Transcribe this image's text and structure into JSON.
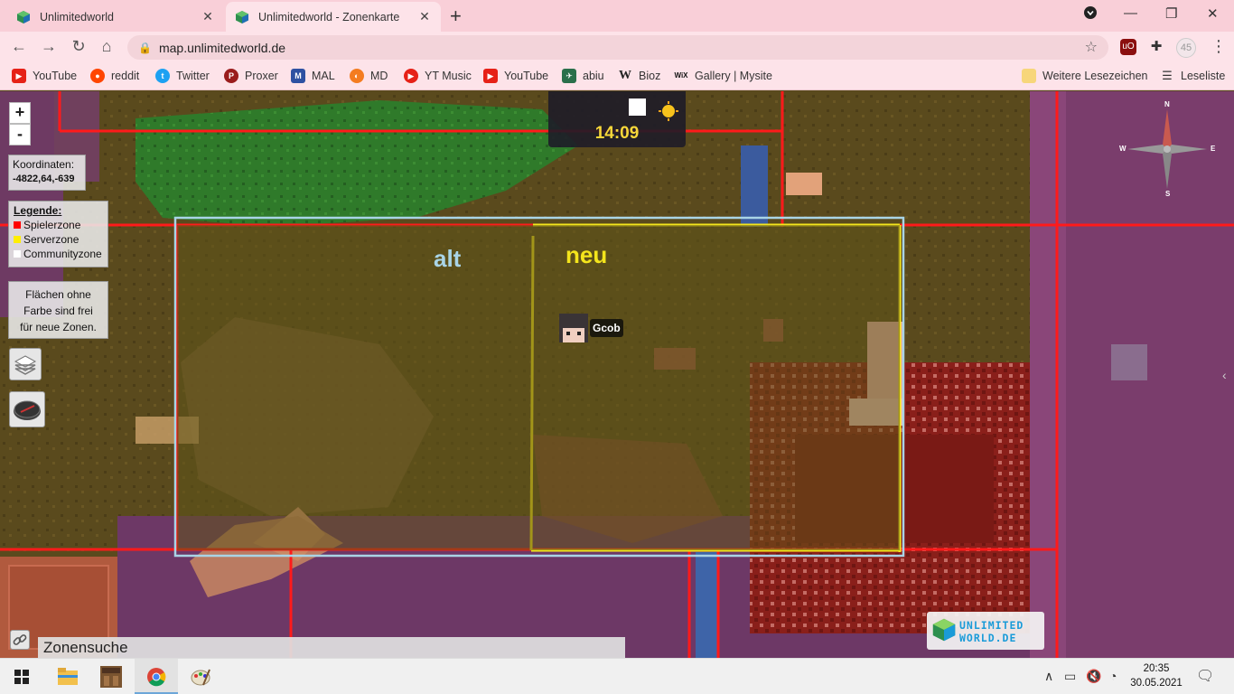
{
  "browser": {
    "tabs": [
      {
        "title": "Unlimitedworld",
        "active": false
      },
      {
        "title": "Unlimitedworld - Zonenkarte",
        "active": true
      }
    ],
    "url": "map.unlimitedworld.de",
    "profile_badge": "45",
    "bookmarks": [
      {
        "label": "YouTube",
        "icon": "youtube-icon",
        "color": "#e62117"
      },
      {
        "label": "reddit",
        "icon": "reddit-icon",
        "color": "#ff4500"
      },
      {
        "label": "Twitter",
        "icon": "twitter-icon",
        "color": "#1da1f2"
      },
      {
        "label": "Proxer",
        "icon": "proxer-icon",
        "color": "#9a1c1c"
      },
      {
        "label": "MAL",
        "icon": "mal-icon",
        "color": "#2e51a2"
      },
      {
        "label": "MD",
        "icon": "md-icon",
        "color": "#f47c20"
      },
      {
        "label": "YT Music",
        "icon": "ytmusic-icon",
        "color": "#e62117"
      },
      {
        "label": "YouTube",
        "icon": "youtube-icon",
        "color": "#e62117"
      },
      {
        "label": "abiu",
        "icon": "abiu-icon",
        "color": "#2a6f4a"
      },
      {
        "label": "Bioz",
        "icon": "wikipedia-icon",
        "color": "#222222"
      },
      {
        "label": "Gallery | Mysite",
        "icon": "wix-icon",
        "color": "#111111"
      }
    ],
    "other_bookmarks": "Weitere Lesezeichen",
    "reading_list": "Leseliste"
  },
  "map": {
    "zoom_in": "+",
    "zoom_out": "-",
    "coordinates_label": "Koordinaten:",
    "coordinates_value": "-4822,64,-639",
    "legend": {
      "title": "Legende:",
      "items": [
        {
          "label": "Spielerzone",
          "color": "#ff0000"
        },
        {
          "label": "Serverzone",
          "color": "#ffee00"
        },
        {
          "label": "Communityzone",
          "color": "#ffffff"
        }
      ]
    },
    "free_area_lines": [
      "Flächen ohne",
      "Farbe sind frei",
      "für neue Zonen."
    ],
    "time": "14:09",
    "label_old": "alt",
    "label_new": "neu",
    "color_old": "#a9d4e6",
    "color_new": "#f4e51c",
    "player_name": "Gcob",
    "compass": {
      "n": "N",
      "s": "S",
      "e": "E",
      "w": "W"
    },
    "logo_line1": "UNLIMITED",
    "logo_line2": "WORLD.DE",
    "search_placeholder": "Zonensuche"
  },
  "taskbar": {
    "time": "20:35",
    "date": "30.05.2021"
  }
}
